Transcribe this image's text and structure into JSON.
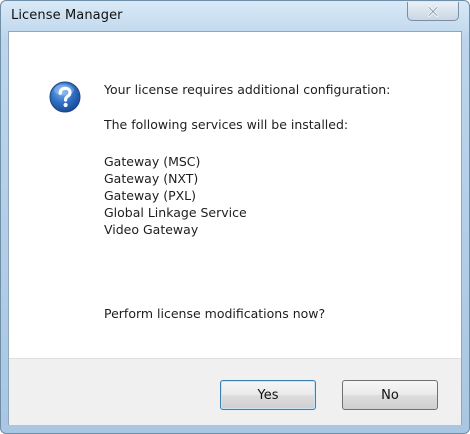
{
  "window": {
    "title": "License Manager",
    "accent_color": "#3c7fb1"
  },
  "dialog": {
    "icon": "question-icon",
    "message": "Your license requires additional configuration:",
    "services_heading": "The following services will be installed:",
    "services": [
      "Gateway (MSC)",
      "Gateway (NXT)",
      "Gateway (PXL)",
      "Global Linkage Service",
      "Video Gateway"
    ],
    "prompt": "Perform license modifications now?"
  },
  "buttons": {
    "yes_label": "Yes",
    "no_label": "No",
    "close_icon": "close-icon"
  }
}
